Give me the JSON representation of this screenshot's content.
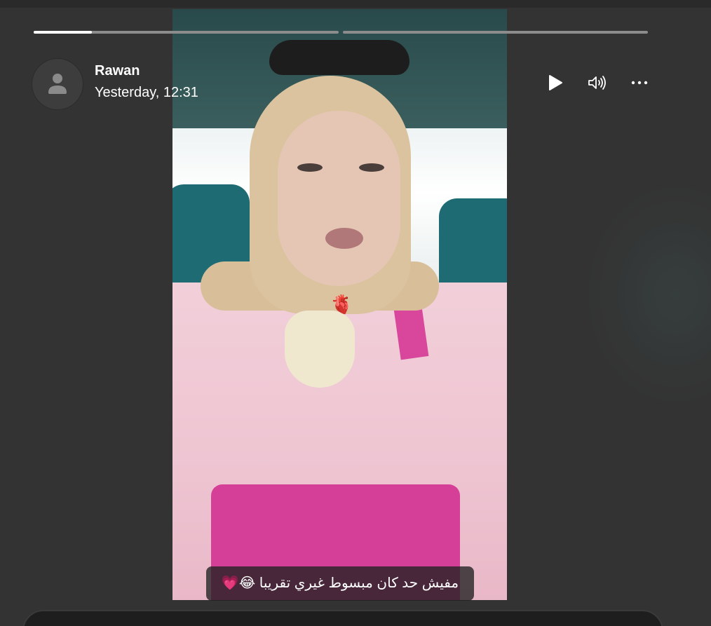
{
  "story": {
    "author": "Rawan",
    "timestamp": "Yesterday, 12:31",
    "caption": "مفيش حد كان مبسوط غيري تقريبا 😂💗",
    "sticker": "🫀",
    "segments": [
      {
        "progress": 0.19
      },
      {
        "progress": 0.0
      }
    ]
  },
  "controls": {
    "play_icon": "play-icon",
    "volume_icon": "volume-icon",
    "more_icon": "more-icon"
  },
  "colors": {
    "background": "#333333",
    "progress_active": "#ffffff",
    "progress_track": "#8c8c8c",
    "caption_bg": "#202020"
  }
}
